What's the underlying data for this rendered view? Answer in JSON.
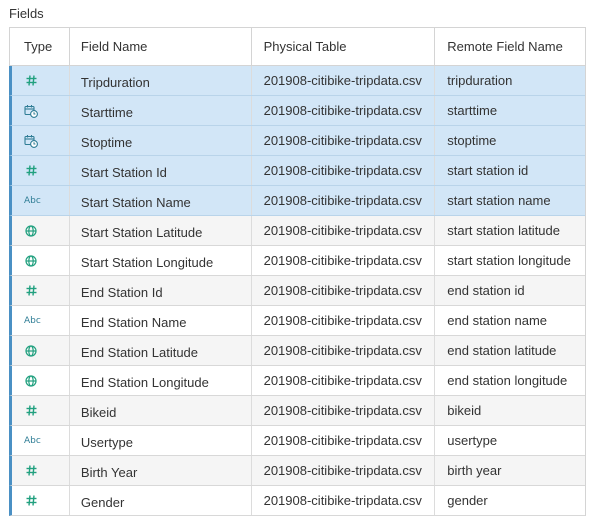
{
  "section_title": "Fields",
  "columns": {
    "type": "Type",
    "field_name": "Field Name",
    "physical_table": "Physical Table",
    "remote_field_name": "Remote Field Name"
  },
  "colors": {
    "accent": "#4a90c4",
    "selected_row": "#d2e6f7",
    "icon_teal": "#21a07f",
    "icon_blue": "#2f7d95"
  },
  "rows": [
    {
      "type_icon": "number-icon",
      "type_label": "",
      "field_name": "Tripduration",
      "physical_table": "201908-citibike-tripdata.csv",
      "remote_field_name": "tripduration",
      "selected": true
    },
    {
      "type_icon": "datetime-icon",
      "type_label": "",
      "field_name": "Starttime",
      "physical_table": "201908-citibike-tripdata.csv",
      "remote_field_name": "starttime",
      "selected": true
    },
    {
      "type_icon": "datetime-icon",
      "type_label": "",
      "field_name": "Stoptime",
      "physical_table": "201908-citibike-tripdata.csv",
      "remote_field_name": "stoptime",
      "selected": true
    },
    {
      "type_icon": "number-icon",
      "type_label": "",
      "field_name": "Start Station Id",
      "physical_table": "201908-citibike-tripdata.csv",
      "remote_field_name": "start station id",
      "selected": true
    },
    {
      "type_icon": "string-icon",
      "type_label": "Abc",
      "field_name": "Start Station Name",
      "physical_table": "201908-citibike-tripdata.csv",
      "remote_field_name": "start station name",
      "selected": true
    },
    {
      "type_icon": "globe-icon",
      "type_label": "",
      "field_name": "Start Station Latitude",
      "physical_table": "201908-citibike-tripdata.csv",
      "remote_field_name": "start station latitude",
      "selected": false
    },
    {
      "type_icon": "globe-icon",
      "type_label": "",
      "field_name": "Start Station Longitude",
      "physical_table": "201908-citibike-tripdata.csv",
      "remote_field_name": "start station longitude",
      "selected": false
    },
    {
      "type_icon": "number-icon",
      "type_label": "",
      "field_name": "End Station Id",
      "physical_table": "201908-citibike-tripdata.csv",
      "remote_field_name": "end station id",
      "selected": false
    },
    {
      "type_icon": "string-icon",
      "type_label": "Abc",
      "field_name": "End Station Name",
      "physical_table": "201908-citibike-tripdata.csv",
      "remote_field_name": "end station name",
      "selected": false
    },
    {
      "type_icon": "globe-icon",
      "type_label": "",
      "field_name": "End Station Latitude",
      "physical_table": "201908-citibike-tripdata.csv",
      "remote_field_name": "end station latitude",
      "selected": false
    },
    {
      "type_icon": "globe-icon",
      "type_label": "",
      "field_name": "End Station Longitude",
      "physical_table": "201908-citibike-tripdata.csv",
      "remote_field_name": "end station longitude",
      "selected": false
    },
    {
      "type_icon": "number-icon",
      "type_label": "",
      "field_name": "Bikeid",
      "physical_table": "201908-citibike-tripdata.csv",
      "remote_field_name": "bikeid",
      "selected": false
    },
    {
      "type_icon": "string-icon",
      "type_label": "Abc",
      "field_name": "Usertype",
      "physical_table": "201908-citibike-tripdata.csv",
      "remote_field_name": "usertype",
      "selected": false
    },
    {
      "type_icon": "number-icon",
      "type_label": "",
      "field_name": "Birth Year",
      "physical_table": "201908-citibike-tripdata.csv",
      "remote_field_name": "birth year",
      "selected": false
    },
    {
      "type_icon": "number-icon",
      "type_label": "",
      "field_name": "Gender",
      "physical_table": "201908-citibike-tripdata.csv",
      "remote_field_name": "gender",
      "selected": false
    }
  ]
}
